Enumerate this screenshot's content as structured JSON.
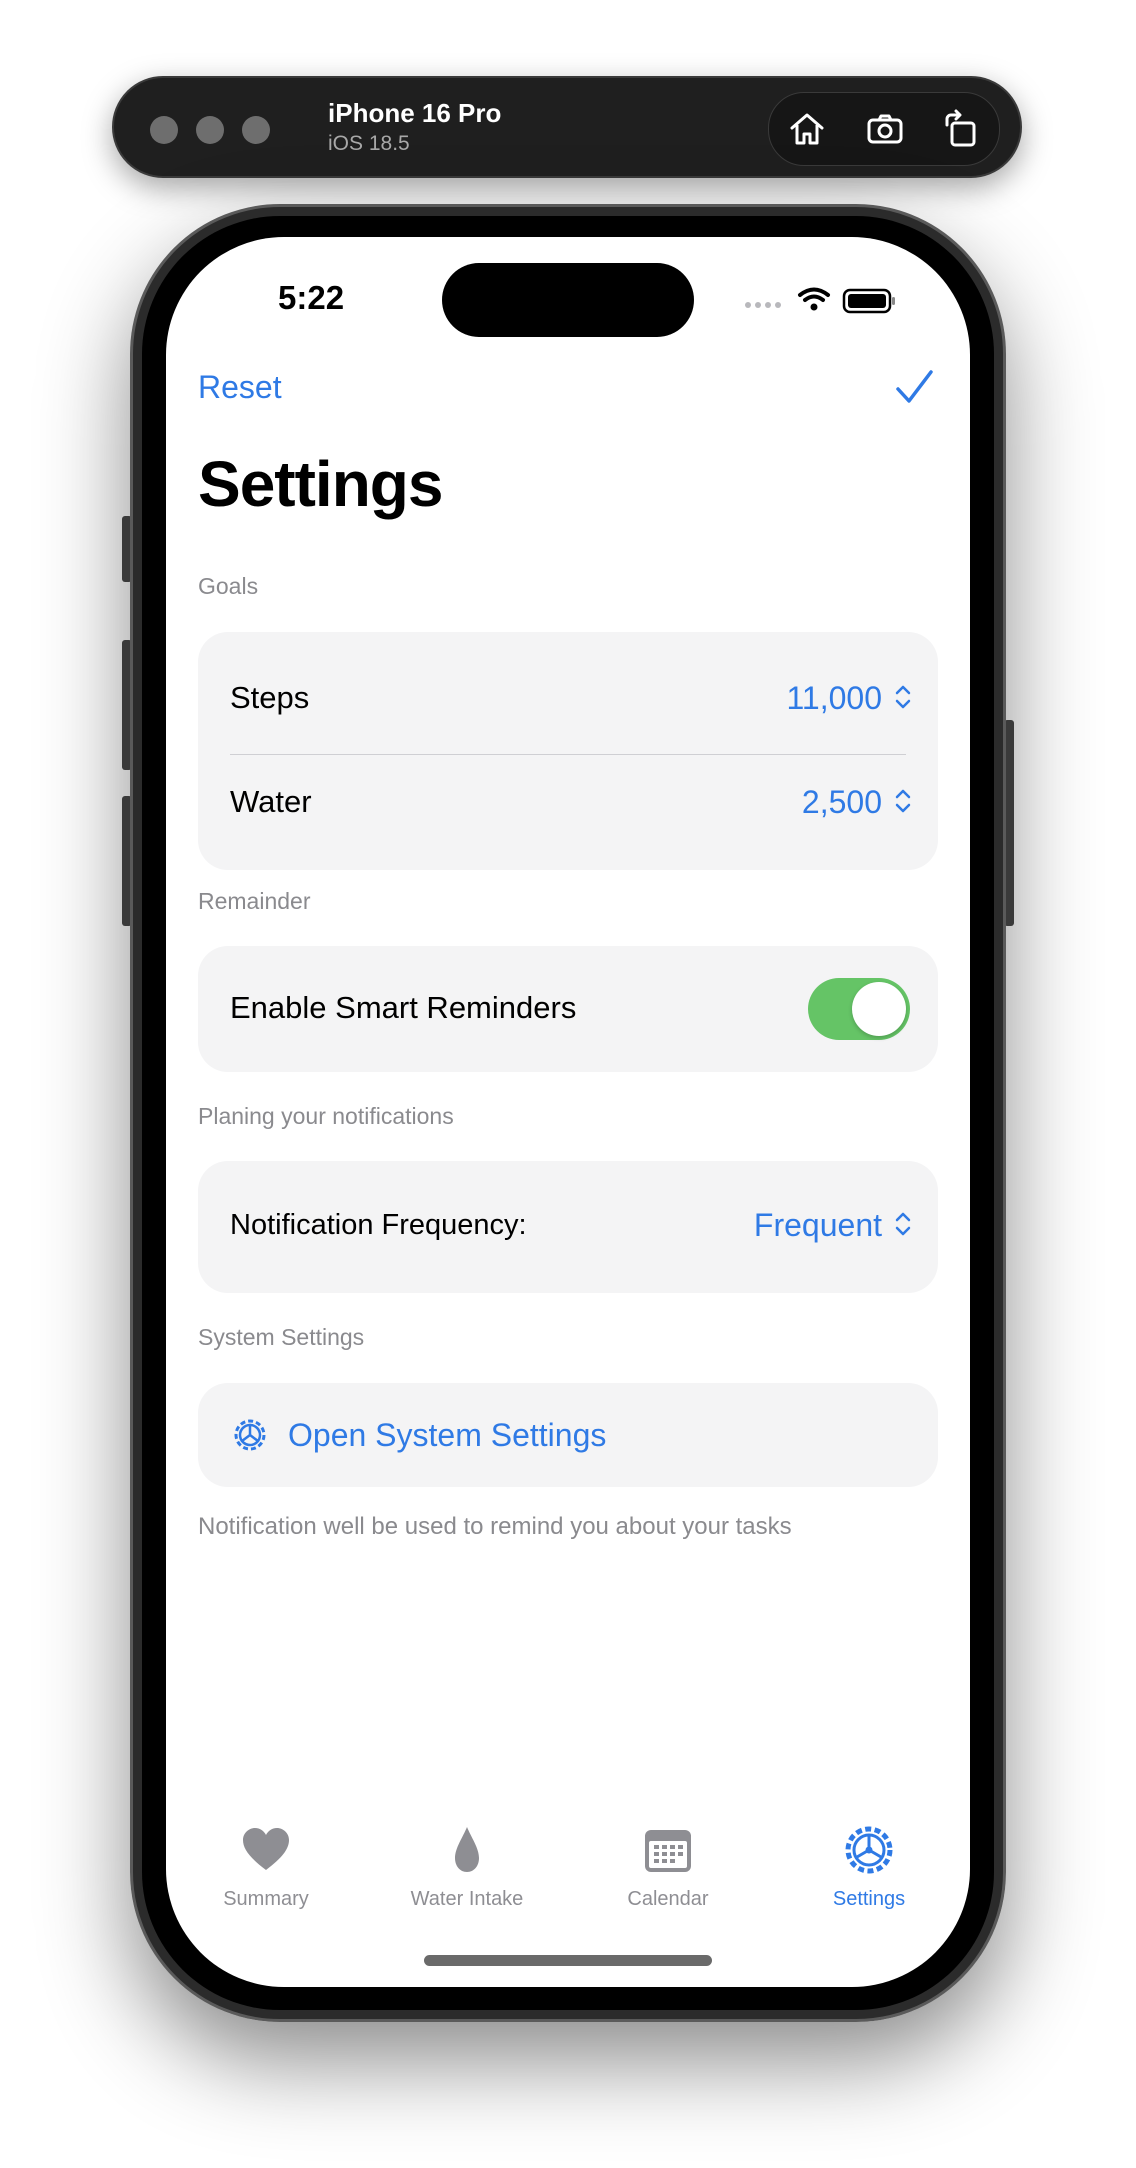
{
  "toolbar": {
    "device_name": "iPhone 16 Pro",
    "os_version": "iOS 18.5",
    "buttons": [
      "home-icon",
      "screenshot-icon",
      "rotate-icon"
    ]
  },
  "status_bar": {
    "time": "5:22"
  },
  "nav": {
    "reset_label": "Reset",
    "done_icon": "checkmark-icon"
  },
  "page": {
    "title": "Settings"
  },
  "goals": {
    "header": "Goals",
    "steps_label": "Steps",
    "steps_value": "11,000",
    "water_label": "Water",
    "water_value": "2,500"
  },
  "reminder": {
    "header": "Remainder",
    "smart_label": "Enable Smart Reminders",
    "smart_enabled": true
  },
  "notifications": {
    "header": "Planing your notifications",
    "frequency_label": "Notification Frequency:",
    "frequency_value": "Frequent"
  },
  "system": {
    "header": "System Settings",
    "open_label": "Open System Settings",
    "footer": "Notification well be used to remind you about your tasks"
  },
  "tabbar": {
    "tabs": [
      {
        "label": "Summary",
        "icon": "heart-icon",
        "active": false
      },
      {
        "label": "Water Intake",
        "icon": "drop-icon",
        "active": false
      },
      {
        "label": "Calendar",
        "icon": "calendar-icon",
        "active": false
      },
      {
        "label": "Settings",
        "icon": "gear-icon",
        "active": true
      }
    ]
  },
  "colors": {
    "accent": "#2f7ae5",
    "toggle_on": "#65c466",
    "card_bg": "#f4f4f5",
    "secondary_text": "#8a8a8e"
  }
}
